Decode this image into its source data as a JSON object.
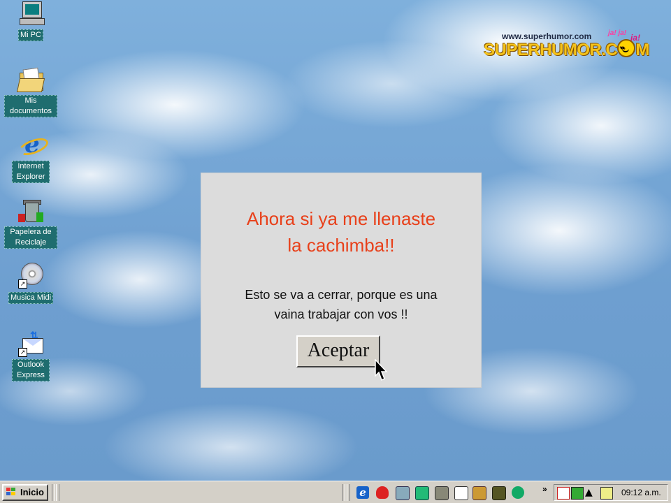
{
  "desktop": {
    "icons": [
      {
        "label": "Mi PC",
        "icon": "computer-icon"
      },
      {
        "label": "Mis documentos",
        "icon": "folder-icon"
      },
      {
        "label": "Internet Explorer",
        "icon": "internet-explorer-icon"
      },
      {
        "label": "Papelera de Reciclaje",
        "icon": "recycle-bin-icon"
      },
      {
        "label": "Musica Midi",
        "icon": "cd-shortcut-icon"
      },
      {
        "label": "Outlook Express",
        "icon": "outlook-express-icon"
      }
    ]
  },
  "logo": {
    "url": "www.superhumor.com",
    "brand_part1": "SUPERHUMOR.C",
    "brand_part2": "M",
    "laugh_small": "ja! ja!",
    "laugh": "ja!"
  },
  "dialog": {
    "title_line1": "Ahora si ya me llenaste",
    "title_line2": "la cachimba!!",
    "message_line1": "Esto se va a cerrar, porque es una",
    "message_line2": "vaina trabajar con vos !!",
    "button_label": "Aceptar",
    "title_color": "#e8401a"
  },
  "taskbar": {
    "start_label": "Inicio",
    "quick_launch": [
      "internet-explorer-icon",
      "shield-icon",
      "network-icon",
      "calculator-icon",
      "printer-icon",
      "edit-icon",
      "people-icon",
      "media-icon",
      "globe-icon"
    ],
    "chevron": "»",
    "tray_icons": [
      "network-status-icon",
      "display-icon",
      "volume-icon",
      "keyboard-icon"
    ],
    "clock": "09:12 a.m."
  }
}
